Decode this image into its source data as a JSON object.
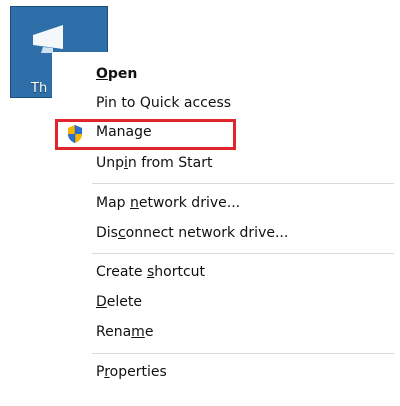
{
  "desktop": {
    "icon_label": "Th",
    "icon_name": "this-pc-icon"
  },
  "context_menu": {
    "groups": [
      [
        {
          "text": "Open",
          "accel_index": 0,
          "bold": true
        },
        {
          "text": "Pin to Quick access",
          "accel_index": null,
          "bold": false
        },
        {
          "text": "Manage",
          "accel_index": null,
          "bold": false,
          "icon": "uac-shield-icon",
          "highlighted": true
        },
        {
          "text": "Unpin from Start",
          "accel_index": 3,
          "bold": false
        }
      ],
      [
        {
          "text": "Map network drive...",
          "accel_index": 4,
          "bold": false
        },
        {
          "text": "Disconnect network drive...",
          "accel_index": 3,
          "bold": false
        }
      ],
      [
        {
          "text": "Create shortcut",
          "accel_index": 7,
          "bold": false
        },
        {
          "text": "Delete",
          "accel_index": 0,
          "bold": false
        },
        {
          "text": "Rename",
          "accel_index": 4,
          "bold": false
        }
      ],
      [
        {
          "text": "Properties",
          "accel_index": 1,
          "bold": false
        }
      ]
    ]
  },
  "colors": {
    "highlight_border": "#e0252d",
    "desktop_icon_bg": "#2f6fa9",
    "separator": "#d9d9d9"
  }
}
